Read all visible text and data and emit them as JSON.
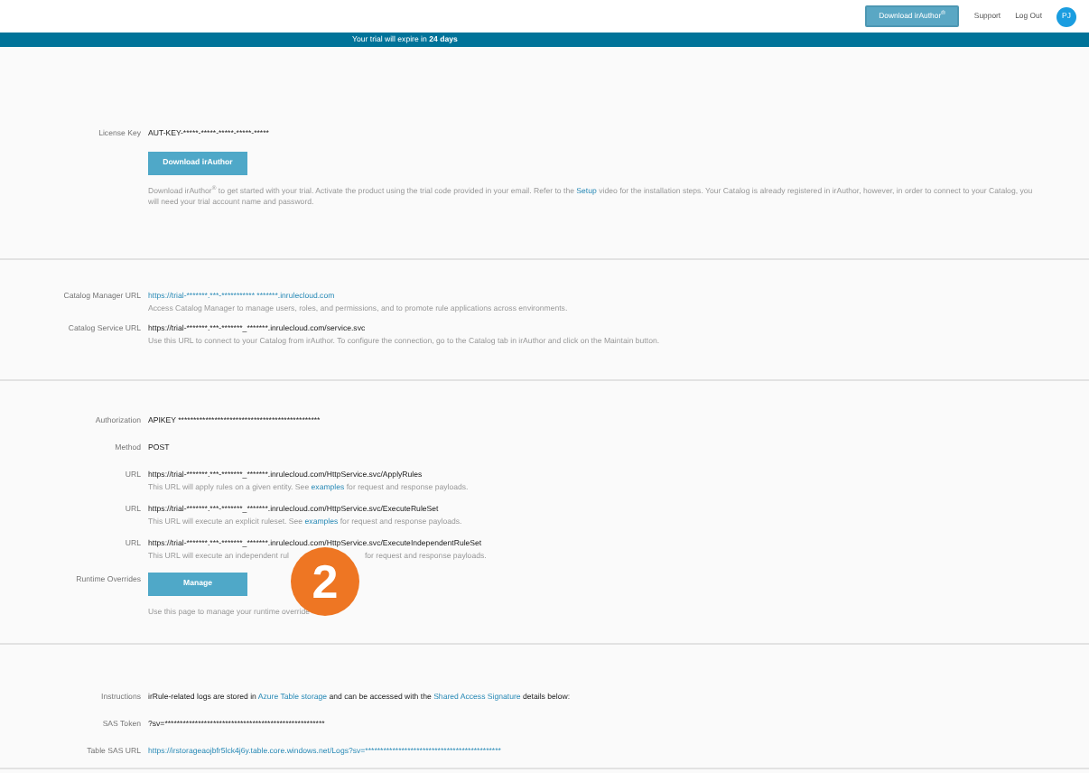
{
  "header": {
    "download_button": "Download irAuthor$^{®}$",
    "links": [
      "Support",
      "Log Out"
    ],
    "avatar": "PJ"
  },
  "trial_banner": "Your trial will expire  in **24 days**",
  "sections": [
    {
      "rows": [
        {
          "label": "License Key",
          "kind": "text",
          "value": "AUT-KEY-*****-*****-*****-*****-*****"
        },
        {
          "label": "",
          "kind": "button",
          "value": "Download irAuthor",
          "desc": [
            {
              "text": "Download irAuthor$^{®}$ to get started with your trial. Activate the product using the trial code provided in your email. Refer to the ",
              "link": false
            },
            {
              "text": "Setup",
              "link": true
            },
            {
              "text": " video for the installation steps. Your Catalog is already registered in irAuthor, however, in order to connect to your Catalog, you will need your trial account name and password.",
              "link": false
            }
          ]
        }
      ]
    },
    {
      "rows": [
        {
          "label": "Catalog Manager URL",
          "kind": "link",
          "value": "https://trial-*******.***-*********** *******.inrulecloud.com",
          "desc": [
            {
              "text": "Access Catalog Manager to manage users, roles, and permissions, and to promote rule applications across environments.",
              "link": false
            }
          ]
        },
        {
          "label": "Catalog Service URL",
          "kind": "text",
          "value": "https://trial-*******.***-*******_*******.inrulecloud.com/service.svc",
          "desc": [
            {
              "text": "Use this URL to connect to your Catalog from irAuthor. To configure the connection, go to the Catalog tab in irAuthor and click on the Maintain button.",
              "link": false
            }
          ]
        }
      ]
    },
    {
      "rows": [
        {
          "label": "Authorization",
          "kind": "text",
          "value": "APIKEY ***********************************************"
        },
        {
          "label": "Method",
          "kind": "text",
          "value": "POST"
        },
        {
          "label": "URL",
          "kind": "text",
          "value": "https://trial-*******.***-*******_*******.inrulecloud.com/HttpService.svc/ApplyRules",
          "desc": [
            {
              "text": "This URL will apply rules on a given entity. See ",
              "link": false
            },
            {
              "text": "examples",
              "link": true
            },
            {
              "text": " for request and response payloads.",
              "link": false
            }
          ]
        },
        {
          "label": "URL",
          "kind": "text",
          "value": "https://trial-*******.***-*******_*******.inrulecloud.com/HttpService.svc/ExecuteRuleSet",
          "desc": [
            {
              "text": "This URL will execute an explicit ruleset. See ",
              "link": false
            },
            {
              "text": "examples",
              "link": true
            },
            {
              "text": " for request and response payloads.",
              "link": false
            }
          ]
        },
        {
          "label": "URL",
          "kind": "text",
          "value": "https://trial-*******.***-*******_*******.inrulecloud.com/HttpService.svc/ExecuteIndependentRuleSet",
          "desc": [
            {
              "text": "This URL will execute an independent rul",
              "link": false
            },
            {
              "text": "for request and response payloads.",
              "link": false,
              "gap": true
            }
          ]
        },
        {
          "label": "Runtime Overrides",
          "kind": "button",
          "value": "Manage",
          "callout": "2",
          "desc": [
            {
              "text": "Use this page to manage your runtime override",
              "link": false
            }
          ]
        }
      ]
    },
    {
      "rows": [
        {
          "label": "Instructions",
          "kind": "text",
          "value": [
            {
              "text": "irRule-related logs are stored in ",
              "link": false
            },
            {
              "text": "Azure Table storage",
              "link": true
            },
            {
              "text": " and can be accessed with the ",
              "link": false
            },
            {
              "text": "Shared Access Signature",
              "link": true
            },
            {
              "text": " details below:",
              "link": false
            }
          ]
        },
        {
          "label": "SAS Token",
          "kind": "text",
          "value": "?sv=*****************************************************"
        },
        {
          "label": "Table SAS URL",
          "kind": "link",
          "value": "https://irstorageaojbfr5lck4j6y.table.core.windows.net/Logs?sv=*********************************************"
        }
      ]
    }
  ]
}
